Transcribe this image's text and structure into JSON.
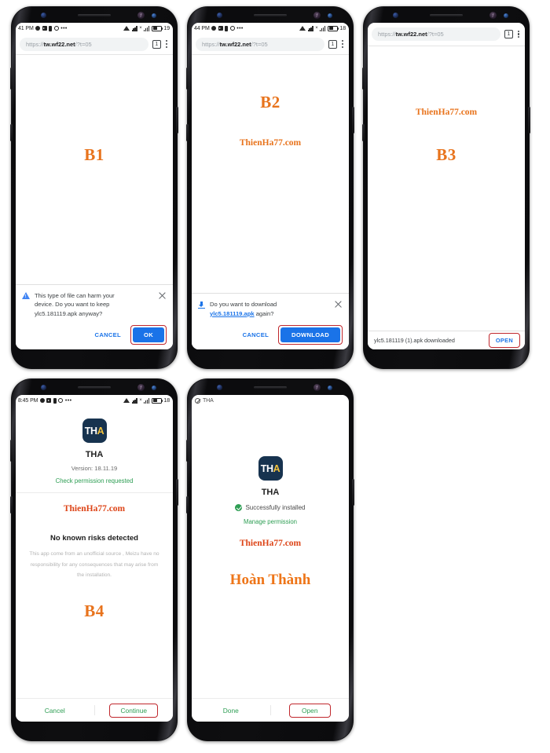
{
  "tutorial": {
    "watermark": "ThienHa77.com",
    "done_label": "Hoàn Thành",
    "accent_orange": "#e8731c",
    "accent_red": "#dd4417",
    "highlight_box_color": "#c0272d",
    "chrome_blue": "#1a73e8",
    "green": "#2e9e54"
  },
  "phones": [
    {
      "step": "B1",
      "status": {
        "time": "41 PM",
        "battery": "19",
        "icons": [
          "circle-icon",
          "video-icon",
          "battery-small-icon",
          "gear-icon",
          "more-icon",
          "wifi-icon",
          "signal-icon",
          "signal-icon",
          "battery-icon"
        ]
      },
      "browser": {
        "url_scheme": "https://",
        "url_host": "tw.wf22.net",
        "url_path": "/?t=05",
        "tab_count": "1"
      },
      "infobar": {
        "icon": "warning-icon",
        "message_line1": "This type of file can harm your",
        "message_line2": "device. Do you want to keep",
        "message_line3": "ylc5.181119.apk anyway?",
        "cancel_label": "CANCEL",
        "confirm_label": "OK",
        "confirm_highlighted": true
      }
    },
    {
      "step": "B2",
      "status": {
        "time": "44 PM",
        "battery": "18"
      },
      "browser": {
        "url_scheme": "https://",
        "url_host": "tw.wf22.net",
        "url_path": "/?t=05",
        "tab_count": "1"
      },
      "infobar": {
        "icon": "download-icon",
        "message_prefix": "Do you want to download",
        "message_link": "ylc5.181119.apk",
        "message_suffix": " again?",
        "cancel_label": "CANCEL",
        "confirm_label": "DOWNLOAD",
        "confirm_highlighted": true
      }
    },
    {
      "step": "B3",
      "browser": {
        "url_scheme": "https://",
        "url_host": "tw.wf22.net",
        "url_path": "/?t=05",
        "tab_count": "1"
      },
      "snackbar": {
        "message": "ylc5.181119 (1).apk downloaded",
        "action_label": "OPEN",
        "action_highlighted": true
      }
    },
    {
      "step": "B4",
      "status": {
        "time": "8:45 PM",
        "battery": "18"
      },
      "installer": {
        "icon_text_a": "TH",
        "icon_text_b": "A",
        "app_name": "THA",
        "version": "Version: 18.11.19",
        "permission_note": "Check permission requested",
        "risk_title": "No known risks detected",
        "risk_body_line1": "This app come from an unofficial source , Meizu have no",
        "risk_body_line2": "responsibility for any consequences that may arise from",
        "risk_body_line3": "the installation.",
        "cancel_label": "Cancel",
        "continue_label": "Continue",
        "continue_highlighted": true
      }
    },
    {
      "step": "",
      "status": {
        "mini_icon": "blocked-icon",
        "mini_label": "THA"
      },
      "installer": {
        "icon_text_a": "TH",
        "icon_text_b": "A",
        "app_name": "THA",
        "success_label": "Successfully installed",
        "manage_label": "Manage permission",
        "done_label": "Done",
        "open_label": "Open",
        "open_highlighted": true
      }
    }
  ]
}
